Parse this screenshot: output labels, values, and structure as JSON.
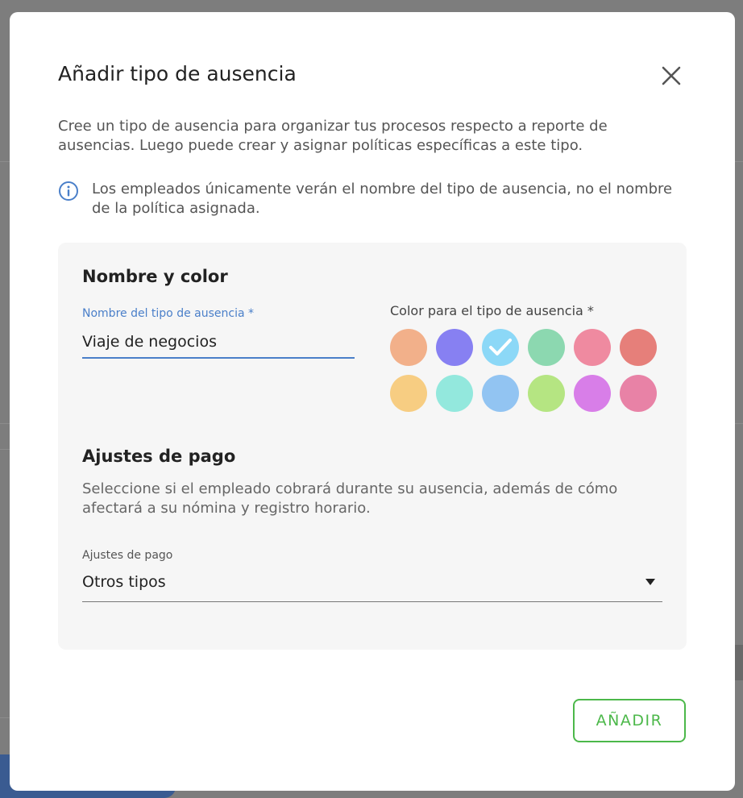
{
  "dialog": {
    "title": "Añadir tipo de ausencia",
    "intro": "Cree un tipo de ausencia para organizar tus procesos respecto a reporte de ausencias. Luego puede crear y asignar políticas específicas a este tipo.",
    "info": "Los empleados únicamente verán el nombre del tipo de ausencia, no el nombre de la política asignada.",
    "submit_label": "AÑADIR"
  },
  "name_color": {
    "section_title": "Nombre y color",
    "name_label": "Nombre del tipo de ausencia *",
    "name_value": "Viaje de negocios",
    "color_label": "Color para el tipo de ausencia *",
    "colors": [
      "#f2b08a",
      "#8780f2",
      "#8cd8f7",
      "#8cd8b0",
      "#ef8aa0",
      "#e67f7a",
      "#f7cd82",
      "#93e8dd",
      "#92c4f2",
      "#b5e582",
      "#d87ee8",
      "#e882a6"
    ],
    "selected_color_index": 2
  },
  "payment": {
    "section_title": "Ajustes de pago",
    "description": "Seleccione si el empleado cobrará durante su ausencia, además de cómo afectará a su nómina y registro horario.",
    "select_label": "Ajustes de pago",
    "select_value": "Otros tipos"
  }
}
